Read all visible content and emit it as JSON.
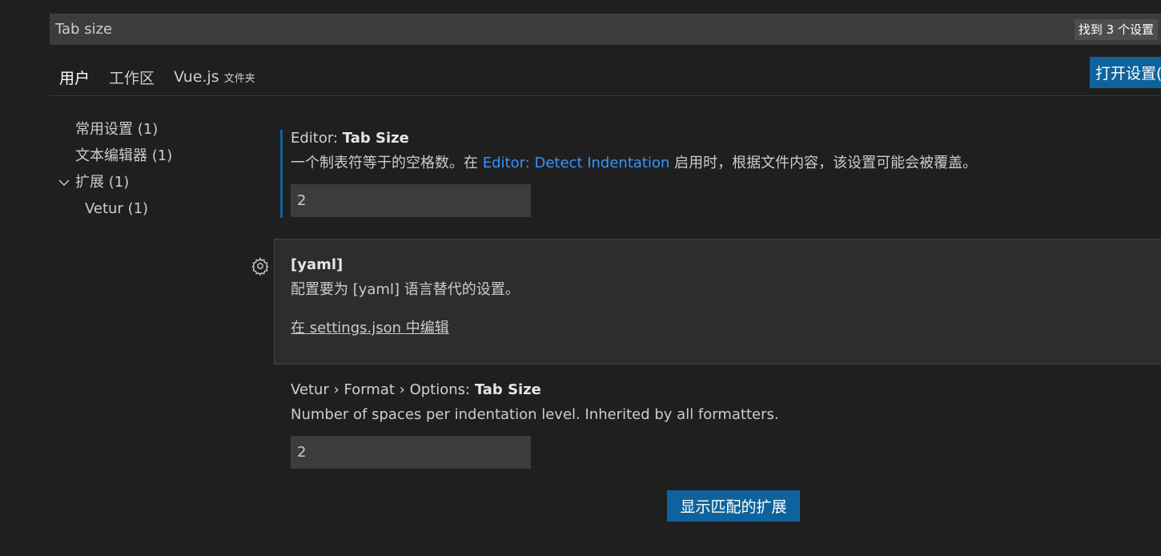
{
  "search": {
    "value": "Tab size",
    "result_count": "找到 3 个设置"
  },
  "tabs": [
    {
      "label": "用户"
    },
    {
      "label": "工作区"
    },
    {
      "label": "Vue.js",
      "suffix": "文件夹"
    }
  ],
  "header": {
    "open_json_label": "打开设置(json)"
  },
  "toc": {
    "items": [
      {
        "label": "常用设置 (1)"
      },
      {
        "label": "文本编辑器 (1)"
      },
      {
        "label": "扩展 (1)"
      },
      {
        "label": "Vetur (1)"
      }
    ]
  },
  "settings": [
    {
      "category": "Editor: ",
      "name": "Tab Size",
      "desc_before": "一个制表符等于的空格数。在 ",
      "desc_link": "Editor: Detect Indentation",
      "desc_after": " 启用时，根据文件内容，该设置可能会被覆盖。",
      "value": "2"
    },
    {
      "name": "[yaml]",
      "desc": "配置要为 [yaml] 语言替代的设置。",
      "edit_link": "在 settings.json 中编辑"
    },
    {
      "category": "Vetur › Format › Options: ",
      "name": "Tab Size",
      "desc": "Number of spaces per indentation level. Inherited by all formatters.",
      "value": "2"
    }
  ],
  "footer": {
    "show_extensions_label": "显示匹配的扩展"
  },
  "colors": {
    "background": "#1f1f1f",
    "accent": "#0e639c",
    "link": "#3794ff"
  }
}
